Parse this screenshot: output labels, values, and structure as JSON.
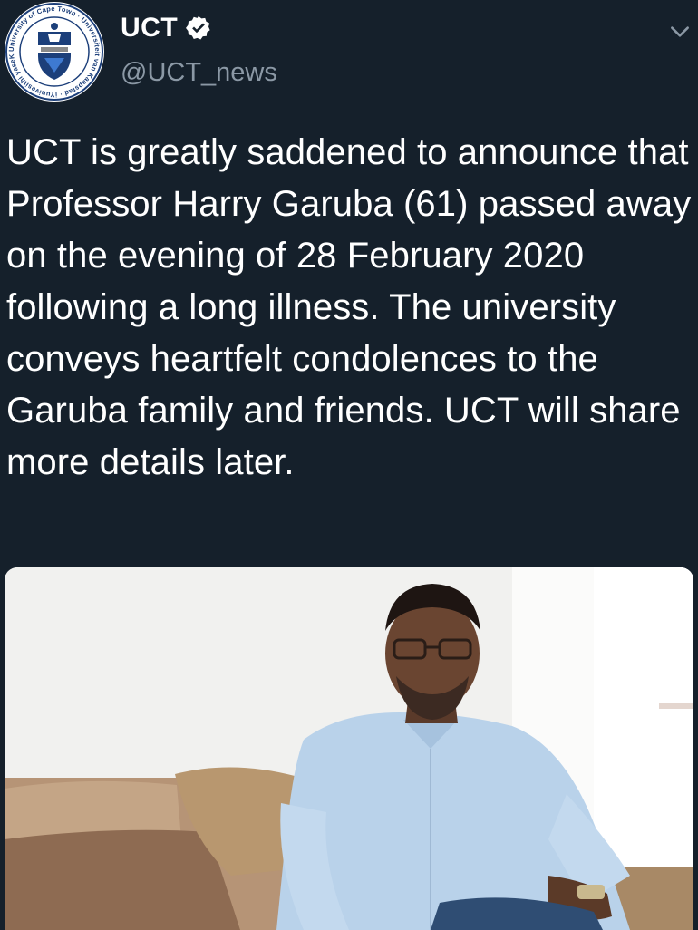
{
  "account": {
    "display_name": "UCT",
    "handle": "@UCT_news",
    "verified": true,
    "avatar_icon": "uct-crest-logo",
    "avatar_ring_text": "University of Cape Town · Universiteit van Kaapstad · iYunivesithi yaseKapa"
  },
  "tweet": {
    "text": "UCT is greatly saddened to announce that Professor Harry Garuba (61) passed away on the evening of 28 February 2020 following a long illness. The university conveys heartfelt condolences to the Garuba family and friends. UCT will share more details later."
  },
  "media": {
    "type": "photo",
    "subject": "man in light blue shirt seated on a sofa"
  },
  "colors": {
    "background": "#15202b",
    "text": "#ffffff",
    "secondary_text": "#8b98a5",
    "verified_badge": "#ffffff"
  },
  "icons": [
    "uct-crest-logo",
    "verified-badge-icon",
    "chevron-down-icon"
  ]
}
